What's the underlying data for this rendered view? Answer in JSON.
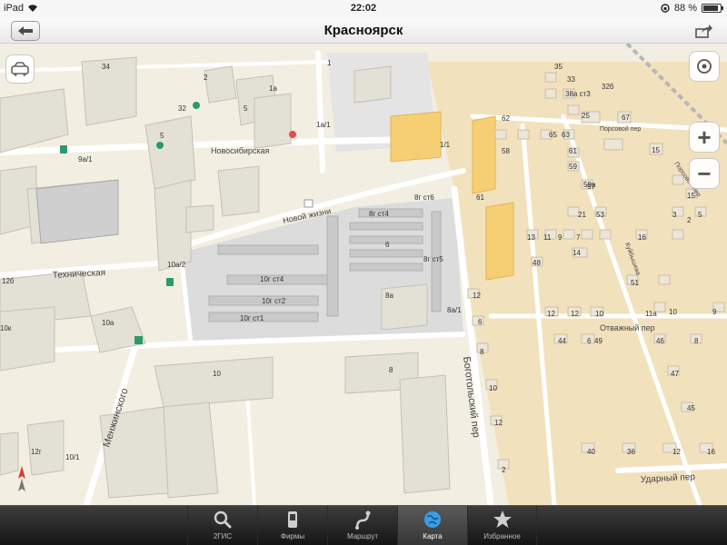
{
  "status_bar": {
    "device": "iPad",
    "time": "22:02",
    "battery": "88 %",
    "battery_level": 0.88
  },
  "nav": {
    "title": "Красноярск"
  },
  "map": {
    "streets": [
      {
        "id": "novosibirskaya",
        "label": "Новосибирская"
      },
      {
        "id": "novoy-zhizni",
        "label": "Новой жизни"
      },
      {
        "id": "tekhnicheskaya",
        "label": "Техническая"
      },
      {
        "id": "menzhinskogo",
        "label": "Менжинского"
      },
      {
        "id": "bogotolsky",
        "label": "Боготольский пер"
      },
      {
        "id": "otvazhny",
        "label": "Отважный пер"
      },
      {
        "id": "udarny",
        "label": "Ударный пер"
      },
      {
        "id": "porsovoy",
        "label": "Порсовой пер"
      },
      {
        "id": "kubysheva",
        "label": "Куйбышева"
      },
      {
        "id": "porsovoy-lower",
        "label": "Порсовой пер"
      }
    ],
    "building_numbers": [
      "34",
      "32",
      "5",
      "9а/1",
      "1а",
      "1а/1",
      "1/1",
      "1",
      "2",
      "5",
      "12б",
      "10а/2",
      "10а",
      "10к",
      "8г ст6",
      "8г ст4",
      "8г ст5",
      "10г ст4",
      "10г ст2",
      "10г ст1",
      "8а",
      "8а/1",
      "10",
      "8",
      "12г",
      "10/1",
      "6",
      "62",
      "58",
      "61",
      "15",
      "13",
      "11",
      "9",
      "7",
      "48",
      "16",
      "12",
      "10",
      "44",
      "47",
      "45",
      "40",
      "36",
      "35",
      "33",
      "38а ст3",
      "32б",
      "25",
      "67",
      "65",
      "63",
      "61",
      "59",
      "59а",
      "57",
      "53",
      "51",
      "49",
      "46",
      "12",
      "11а",
      "14",
      "21",
      "15",
      "2",
      "3",
      "5",
      "10",
      "9",
      "6",
      "8",
      "12",
      "16",
      "12",
      "6",
      "8",
      "10",
      "12",
      "2"
    ]
  },
  "tabs": [
    {
      "id": "2gis",
      "label": "2ГИС",
      "icon": "search-icon"
    },
    {
      "id": "firms",
      "label": "Фирмы",
      "icon": "phone-icon"
    },
    {
      "id": "route",
      "label": "Маршрут",
      "icon": "route-icon"
    },
    {
      "id": "map",
      "label": "Карта",
      "icon": "globe-icon",
      "active": true
    },
    {
      "id": "favorites",
      "label": "Избранное",
      "icon": "star-icon"
    }
  ],
  "controls": {
    "zoom_in": "+",
    "zoom_out": "−"
  },
  "colors": {
    "map_bg": "#f2eee2",
    "private_sector": "#f2e1bd",
    "highlight_building": "#f6cf75",
    "accent": "#3b9ee4"
  }
}
